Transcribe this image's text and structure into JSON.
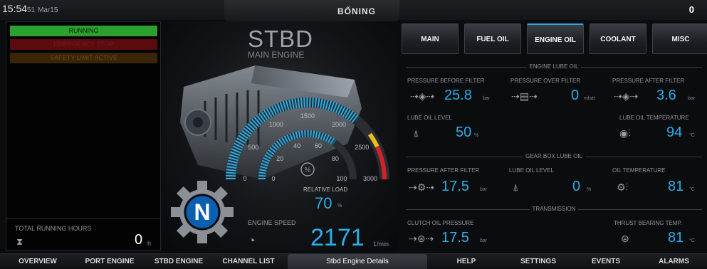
{
  "topbar": {
    "time": "15:54",
    "seconds": "51",
    "date": "Mar15",
    "brand": "BŐNING",
    "alarm_count": "0"
  },
  "status": {
    "running": "RUNNING",
    "shutdown": "EMERGENCY STOP",
    "safety": "SAFETY LIMIT ACTIVE"
  },
  "hours": {
    "label": "TOTAL RUNNING HOURS",
    "value": "0",
    "unit": "h"
  },
  "engine": {
    "title": "STBD",
    "subtitle": "MAIN ENGINE",
    "gear": "N",
    "rpm_ticks": [
      "0",
      "500",
      "1000",
      "1500",
      "2000",
      "2500",
      "3000"
    ],
    "load_ticks": [
      "0",
      "20",
      "40",
      "60",
      "80",
      "100"
    ],
    "load_label": "RELATIVE LOAD",
    "load_value": "70",
    "load_unit": "%",
    "speed_label": "ENGINE SPEED",
    "speed_value": "2171",
    "speed_unit": "1/min",
    "rpm_fraction": 0.72,
    "load_fraction": 0.7
  },
  "tabs": [
    "MAIN",
    "FUEL OIL",
    "ENGINE OIL",
    "COOLANT",
    "MISC"
  ],
  "engine_lube": {
    "title": "ENGINE LUBE OIL",
    "p_before_label": "PRESSURE BEFORE FILTER",
    "p_before_value": "25.8",
    "p_before_unit": "bar",
    "p_over_label": "PRESSURE OVER FILTER",
    "p_over_value": "0",
    "p_over_unit": "mbar",
    "p_after_label": "PRESSURE AFTER FILTER",
    "p_after_value": "3.6",
    "p_after_unit": "bar",
    "level_label": "LUBE OIL LEVEL",
    "level_value": "50",
    "level_unit": "%",
    "temp_label": "LUBE OIL TEMPERATURE",
    "temp_value": "94",
    "temp_unit": "°C"
  },
  "gearbox": {
    "title": "GEAR BOX LUBE OIL",
    "p_after_label": "PRESSURE AFTER FILTER",
    "p_after_value": "17.5",
    "p_after_unit": "bar",
    "level_label": "LUBE OIL LEVEL",
    "level_value": "0",
    "level_unit": "%",
    "temp_label": "OIL TEMPERATURE",
    "temp_value": "81",
    "temp_unit": "°C"
  },
  "transmission": {
    "title": "TRANSMISSION",
    "clutch_label": "CLUTCH OIL PRESSURE",
    "clutch_value": "17.5",
    "clutch_unit": "bar",
    "thrust_label": "THRUST BEARING TEMP.",
    "thrust_value": "81",
    "thrust_unit": "°C"
  },
  "nav": [
    "OVERVIEW",
    "PORT ENGINE",
    "STBD ENGINE",
    "CHANNEL LIST",
    "Stbd Engine Details",
    "HELP",
    "SETTINGS",
    "EVENTS",
    "ALARMS"
  ],
  "colors": {
    "accent": "#29aee8",
    "running": "#2ca02c",
    "gauge_red": "#d0222a",
    "gauge_yellow": "#e6c21a"
  }
}
